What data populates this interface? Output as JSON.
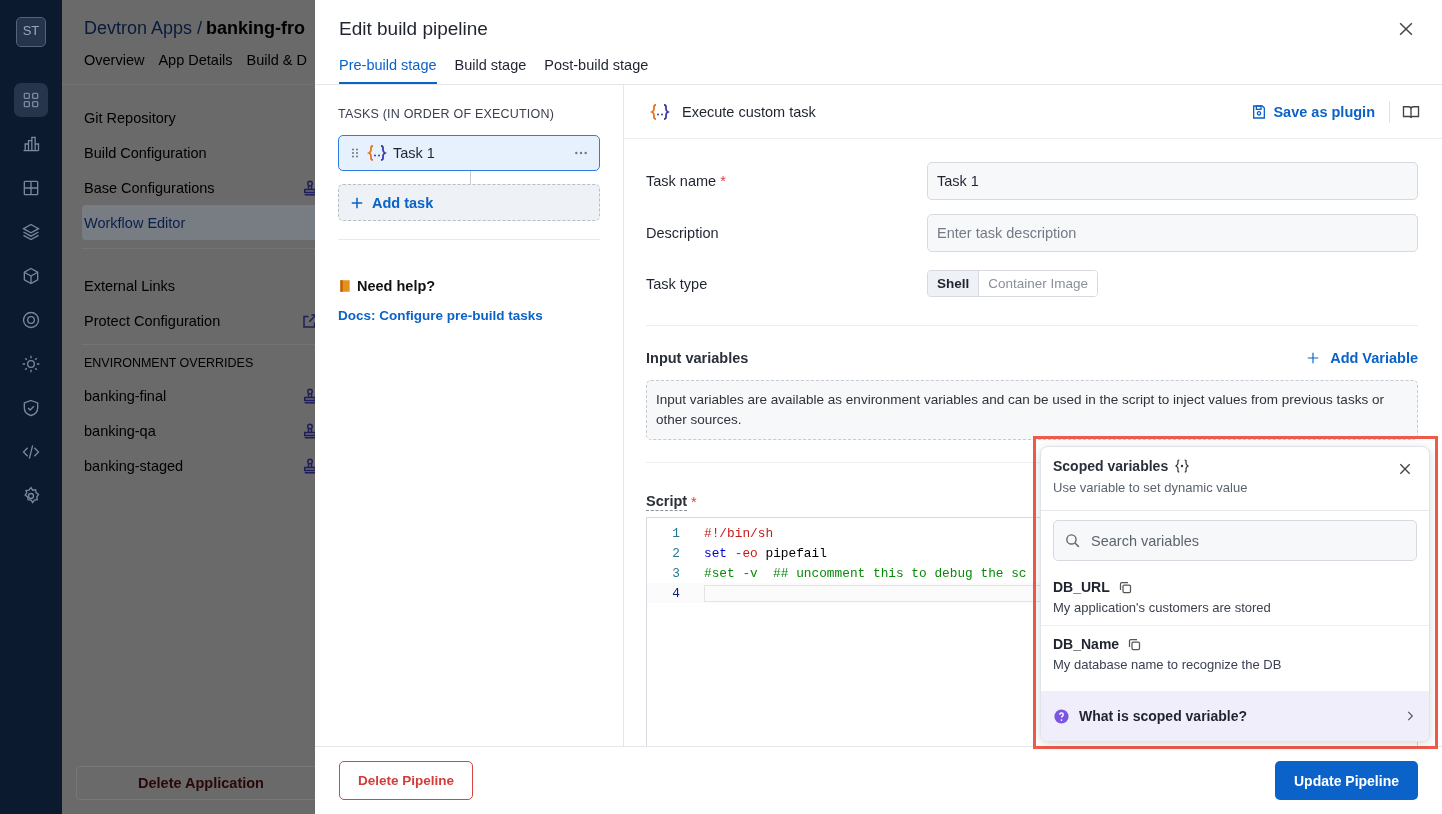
{
  "rail": {
    "logo": "ST",
    "items": [
      {
        "kind": "grid",
        "selected": true
      },
      {
        "kind": "chart",
        "selected": false
      },
      {
        "kind": "apps",
        "selected": false
      },
      {
        "kind": "layers",
        "selected": false
      },
      {
        "kind": "cube",
        "selected": false
      },
      {
        "kind": "target",
        "selected": false
      },
      {
        "kind": "sun",
        "selected": false
      },
      {
        "kind": "shield",
        "selected": false
      },
      {
        "kind": "code",
        "selected": false
      },
      {
        "kind": "gear",
        "selected": false
      }
    ]
  },
  "app": {
    "breadcrumb": "Devtron Apps /",
    "title": "banking-fro",
    "tabs": [
      "Overview",
      "App Details",
      "Build & D"
    ],
    "menu": [
      {
        "kind": "item",
        "label": "Git Repository",
        "selected": false
      },
      {
        "kind": "item",
        "label": "Build Configuration",
        "selected": false
      },
      {
        "kind": "stamp_item",
        "label": "Base Configurations",
        "selected": false
      },
      {
        "kind": "item",
        "label": "Workflow Editor",
        "selected": true
      },
      {
        "kind": "gap"
      },
      {
        "kind": "item",
        "label": "External Links",
        "selected": false
      },
      {
        "kind": "link_item",
        "label": "Protect Configuration",
        "selected": false
      },
      {
        "kind": "heading",
        "label": "ENVIRONMENT OVERRIDES"
      },
      {
        "kind": "stamp_item",
        "label": "banking-final",
        "selected": false
      },
      {
        "kind": "stamp_item",
        "label": "banking-qa",
        "selected": false
      },
      {
        "kind": "stamp_item",
        "label": "banking-staged",
        "selected": false
      }
    ],
    "delete_button": "Delete Application"
  },
  "modal": {
    "title": "Edit build pipeline",
    "tabs": [
      {
        "label": "Pre-build stage",
        "selected": true
      },
      {
        "label": "Build stage",
        "selected": false
      },
      {
        "label": "Post-build stage",
        "selected": false
      }
    ],
    "tasks_heading": "TASKS (IN ORDER OF EXECUTION)",
    "tasks": [
      {
        "name": "Task 1",
        "selected": true
      }
    ],
    "add_task": "Add task",
    "help_title": "Need help?",
    "help_link": "Docs: Configure pre-build tasks",
    "task_header": "Execute custom task",
    "save_plugin": "Save as plugin",
    "fields": [
      {
        "label": "Task name",
        "required_mark": "*",
        "value": "Task 1"
      },
      {
        "label": "Description",
        "placeholder": "Enter task description"
      }
    ],
    "task_type": {
      "label": "Task type",
      "options": [
        {
          "label": "Shell",
          "selected": true
        },
        {
          "label": "Container Image",
          "selected": false
        }
      ]
    },
    "input_variables": {
      "title": "Input variables",
      "add": "Add Variable",
      "info": "Input variables are available as environment variables and can be used in the script to inject values from previous tasks or other sources."
    },
    "script": {
      "label": "Script",
      "required_mark": "*",
      "lines": [
        {
          "number": "1",
          "active": false,
          "tokens": [
            {
              "kind": "shebang",
              "text": "#!/bin/sh"
            }
          ]
        },
        {
          "number": "2",
          "active": false,
          "tokens": [
            {
              "kind": "keyword",
              "text": "set"
            },
            {
              "kind": "flag",
              "text": "-eo"
            },
            {
              "kind": "plain",
              "text": "pipefail"
            }
          ]
        },
        {
          "number": "3",
          "active": false,
          "tokens": [
            {
              "kind": "comment",
              "text": "#set -v  ## uncomment this to debug the sc"
            }
          ]
        },
        {
          "number": "4",
          "active": true
        }
      ]
    },
    "footer": {
      "delete": "Delete Pipeline",
      "update": "Update Pipeline"
    }
  },
  "scoped_variables": {
    "title": "Scoped variables",
    "subtitle": "Use variable to set dynamic value",
    "search_placeholder": "Search variables",
    "variables": [
      {
        "name": "DB_URL",
        "description": "My application's customers are stored"
      },
      {
        "name": "DB_Name",
        "description": "My database name to recognize the DB"
      }
    ],
    "help": "What is scoped variable?"
  }
}
